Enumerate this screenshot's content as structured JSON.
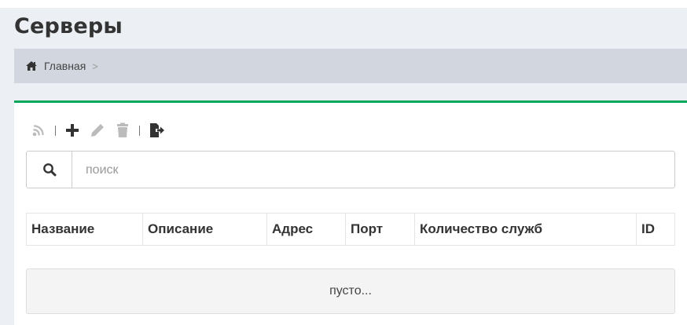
{
  "page": {
    "title": "Серверы",
    "accent_color": "#00a65a"
  },
  "breadcrumb": {
    "home_icon": "home-icon",
    "home_label": "Главная",
    "separator": ">"
  },
  "toolbar": {
    "buttons": [
      {
        "name": "refresh-button",
        "icon": "signal-icon",
        "enabled": false
      },
      {
        "name": "add-button",
        "icon": "plus-icon",
        "enabled": true
      },
      {
        "name": "edit-button",
        "icon": "pencil-icon",
        "enabled": false
      },
      {
        "name": "delete-button",
        "icon": "trash-icon",
        "enabled": false
      },
      {
        "name": "export-button",
        "icon": "export-icon",
        "enabled": true
      }
    ]
  },
  "search": {
    "placeholder": "поиск",
    "value": ""
  },
  "table": {
    "columns": [
      "Название",
      "Описание",
      "Адрес",
      "Порт",
      "Количество служб",
      "ID"
    ],
    "rows": []
  },
  "empty_message": "пусто..."
}
